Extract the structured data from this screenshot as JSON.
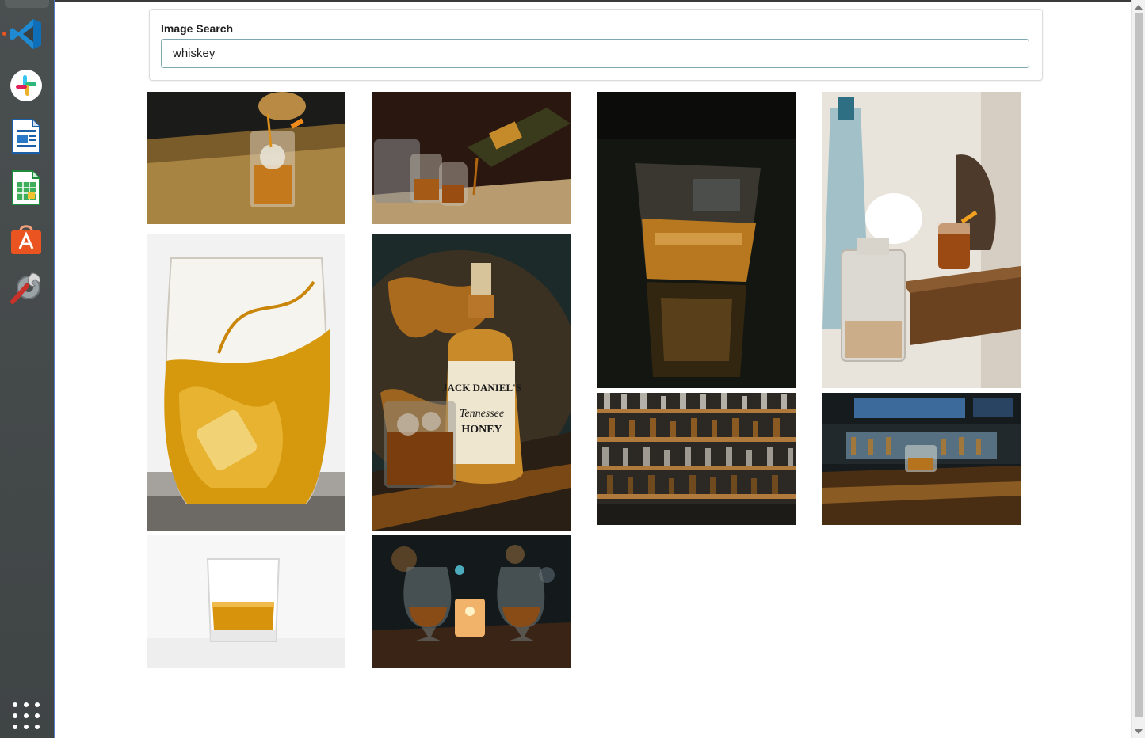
{
  "dock": {
    "items": [
      {
        "name": "vscode-icon"
      },
      {
        "name": "slack-icon"
      },
      {
        "name": "libreoffice-writer-icon"
      },
      {
        "name": "libreoffice-calc-icon"
      },
      {
        "name": "software-center-icon"
      },
      {
        "name": "settings-tools-icon"
      }
    ],
    "apps_grid_icon": "show-applications-icon"
  },
  "search": {
    "label": "Image Search",
    "value": "whiskey",
    "placeholder": ""
  },
  "results": [
    {
      "subject": "whiskey-poured-over-ice-photo"
    },
    {
      "subject": "whiskey-pouring-into-glasses-photo"
    },
    {
      "subject": "whiskey-tumbler-dark-photo"
    },
    {
      "subject": "decanter-and-cocktail-photo"
    },
    {
      "subject": "whiskey-splash-glass-photo"
    },
    {
      "subject": "tennessee-honey-bottle-photo"
    },
    {
      "subject": "bar-shelves-bottles-photo"
    },
    {
      "subject": "bar-counter-glass-photo"
    },
    {
      "subject": "whiskey-glass-white-photo"
    },
    {
      "subject": "glencairn-glasses-candle-photo"
    }
  ],
  "bottle_label": {
    "brand": "JACK DANIEL'S",
    "line1": "Tennessee",
    "line2": "HONEY"
  },
  "colors": {
    "accent_border": "#7fa7b2",
    "dock_running": "#e95420"
  }
}
